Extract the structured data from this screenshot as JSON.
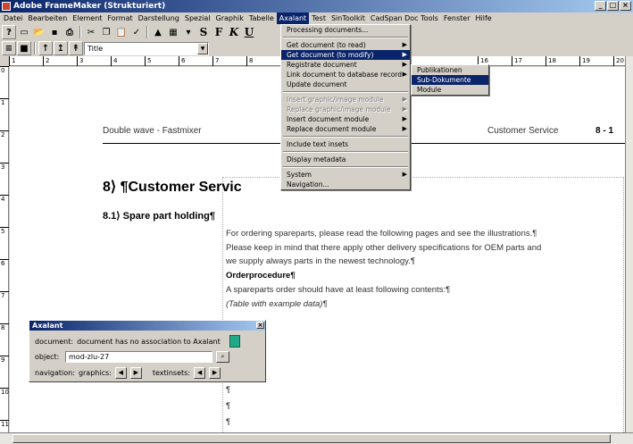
{
  "window": {
    "title": "Adobe FrameMaker (Strukturiert)",
    "minimize": "_",
    "maximize": "□",
    "close": "×"
  },
  "menubar": [
    "Datei",
    "Bearbeiten",
    "Element",
    "Format",
    "Darstellung",
    "Spezial",
    "Graphik",
    "Tabelle",
    "Axalant",
    "Test",
    "SinToolkit",
    "CadSpan Doc Tools",
    "Fenster",
    "Hilfe"
  ],
  "toolbar": {
    "style_value": "Title",
    "format_buttons": [
      "S",
      "F",
      "K",
      "U"
    ]
  },
  "ruler": {
    "h_ticks": [
      "1",
      "2",
      "3",
      "4",
      "5",
      "6",
      "7",
      "8",
      "9",
      "16",
      "17",
      "18",
      "19",
      "20"
    ],
    "v_ticks": [
      "0",
      "1",
      "2",
      "3",
      "4",
      "5",
      "6",
      "7",
      "8",
      "9",
      "10",
      "11"
    ]
  },
  "document": {
    "header_left": "Double wave - Fastmixer",
    "header_right": "Customer Service",
    "header_page": "8 - 1",
    "heading1": "8⟩   ¶Customer Servic",
    "heading2": "8.1⟩   Spare part holding¶",
    "paragraphs": [
      "For ordering spareparts, please read the following pages and see the illustrations.¶",
      "Please keep in mind that there apply other delivery specifications for OEM parts and",
      "we supply always parts in the newest technology.¶",
      "Orderprocedure¶",
      "A spareparts order should have at  least following contents:¶",
      "(Table with example data)¶"
    ],
    "pilcrows": [
      "¶",
      "¶",
      "¶"
    ]
  },
  "axalant_menu": {
    "items": [
      {
        "label": "Processing documents...",
        "type": "item"
      },
      {
        "type": "sep"
      },
      {
        "label": "Get document (to read)",
        "type": "sub"
      },
      {
        "label": "Get document (to modify)",
        "type": "sub",
        "highlight": true
      },
      {
        "label": "Registrate document",
        "type": "sub"
      },
      {
        "label": "Link document to database record",
        "type": "sub"
      },
      {
        "label": "Update document",
        "type": "item"
      },
      {
        "type": "sep"
      },
      {
        "label": "Insert graphic/image module",
        "type": "sub",
        "disabled": true
      },
      {
        "label": "Replace graphic/image module",
        "type": "sub",
        "disabled": true
      },
      {
        "label": "Insert document module",
        "type": "sub"
      },
      {
        "label": "Replace document module",
        "type": "sub"
      },
      {
        "type": "sep"
      },
      {
        "label": "Include text insets",
        "type": "item"
      },
      {
        "type": "sep"
      },
      {
        "label": "Display metadata",
        "type": "item"
      },
      {
        "type": "sep"
      },
      {
        "label": "System",
        "type": "sub"
      },
      {
        "label": "Navigation...",
        "type": "item"
      }
    ]
  },
  "submenu": {
    "items": [
      {
        "label": "Publikationen",
        "highlight": false
      },
      {
        "label": "Sub-Dokumente",
        "highlight": true
      },
      {
        "label": "Module",
        "highlight": false
      }
    ]
  },
  "palette": {
    "title": "Axalant",
    "document_label": "document:",
    "document_value": "document has no association to Axalant",
    "object_label": "object:",
    "object_value": "mod-zlu-27",
    "navigation_label": "navigation:",
    "graphics_label": "graphics:",
    "textinsets_label": "textinsets:"
  }
}
